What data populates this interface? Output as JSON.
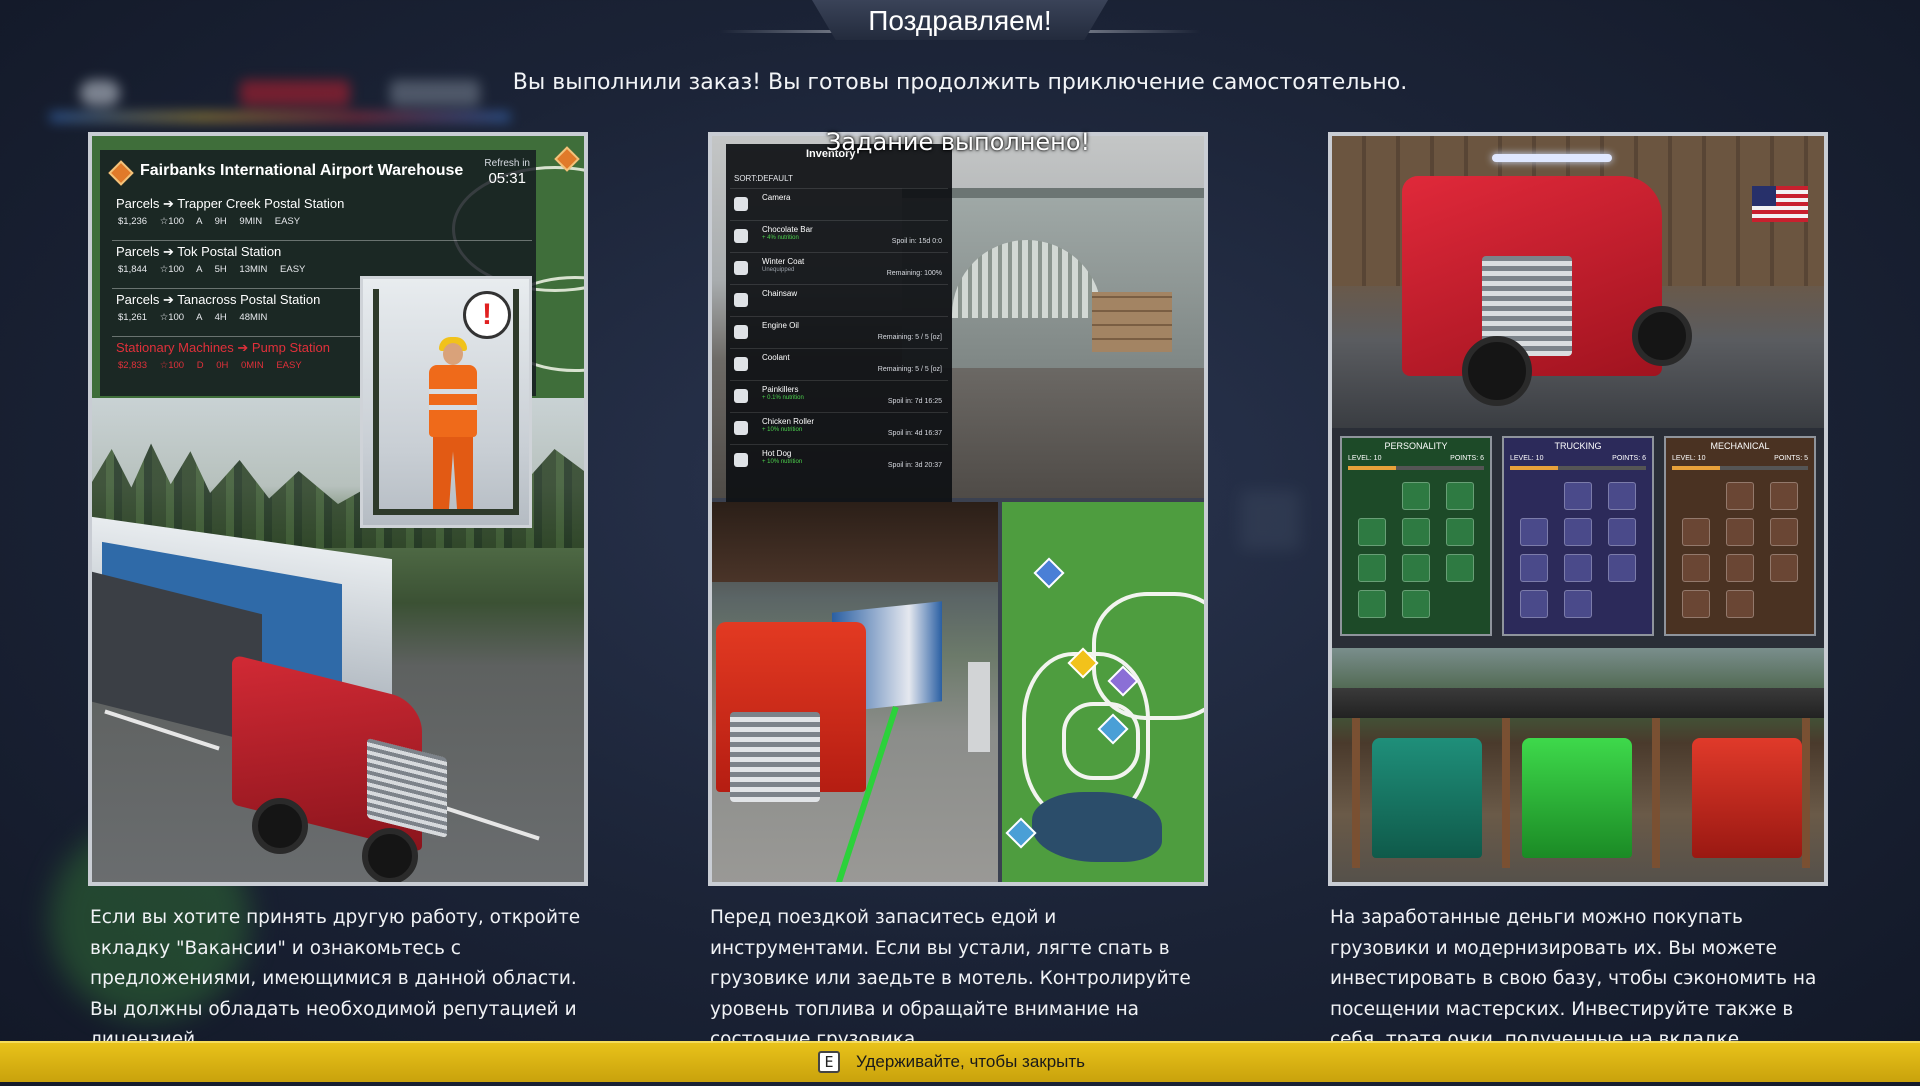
{
  "dialog": {
    "title": "Поздравляем!",
    "subtitle": "Вы выполнили заказ! Вы готовы продолжить приключение самостоятельно.",
    "close_key": "E",
    "close_hint": "Удерживайте, чтобы закрыть"
  },
  "panels": [
    {
      "description": "Если вы хотите принять другую работу, откройте вкладку \"Вакансии\" и ознакомьтесь с предложениями, имеющимися в данной области. Вы должны обладать необходимой репутацией и лицензией.",
      "job_board": {
        "title": "Fairbanks International Airport Warehouse",
        "refresh_label": "Refresh in",
        "refresh_time": "05:31",
        "jobs": [
          {
            "route": "Parcels ➔ Trapper Creek Postal Station",
            "stats": "$1,236 ☆100 A 9H 9MIN EASY",
            "locked": false
          },
          {
            "route": "Parcels ➔ Tok Postal Station",
            "stats": "$1,844 ☆100 A 5H 13MIN EASY",
            "locked": false
          },
          {
            "route": "Parcels ➔ Tanacross Postal Station",
            "stats": "$1,261 ☆100 A 4H 48MIN",
            "locked": false
          },
          {
            "route": "Stationary Machines ➔ Pump Station",
            "stats": "$2,833 ☆100 D 0H 0MIN EASY",
            "locked": true
          }
        ]
      }
    },
    {
      "description": "Перед поездкой запаситесь едой и инструментами. Если вы устали, лягте спать в грузовике или заедьте в мотель. Контролируйте уровень топлива и обращайте внимание на состояние грузовика.",
      "overlay_text": "Задание выполнено!",
      "inventory": {
        "title": "Inventory",
        "sort": "SORT:DEFAULT",
        "items": [
          {
            "name": "Camera",
            "sub": "",
            "info": ""
          },
          {
            "name": "Chocolate Bar",
            "sub": "+ 4% nutrition",
            "info": "Spoil in: 15d 0:0"
          },
          {
            "name": "Winter Coat",
            "sub": "Unequipped",
            "info": "Remaining: 100%"
          },
          {
            "name": "Chainsaw",
            "sub": "",
            "info": ""
          },
          {
            "name": "Engine Oil",
            "sub": "",
            "info": "Remaining: 5 / 5 [oz]"
          },
          {
            "name": "Coolant",
            "sub": "",
            "info": "Remaining: 5 / 5 [oz]"
          },
          {
            "name": "Painkillers",
            "sub": "+ 0.1% nutrition",
            "info": "Spoil in: 7d 16:25"
          },
          {
            "name": "Chicken Roller",
            "sub": "+ 10% nutrition",
            "info": "Spoil in: 4d 16:37"
          },
          {
            "name": "Hot Dog",
            "sub": "+ 10% nutrition",
            "info": "Spoil in: 3d 20:37"
          }
        ]
      }
    },
    {
      "description": " На заработанные деньги можно покупать грузовики и модернизировать их. Вы можете инвестировать в свою базу, чтобы сэкономить на посещении мастерских. Инвестируйте также в себя, тратя очки, полученные на вкладке \"Водитель\".",
      "skill_trees": [
        {
          "title": "PERSONALITY",
          "level": "LEVEL: 10",
          "points": "POINTS: 6",
          "progress": 0.35
        },
        {
          "title": "TRUCKING",
          "level": "LEVEL: 10",
          "points": "POINTS: 6",
          "progress": 0.35
        },
        {
          "title": "MECHANICAL",
          "level": "LEVEL: 10",
          "points": "POINTS: 5",
          "progress": 0.35
        }
      ]
    }
  ],
  "colors": {
    "accent_bar": "#e0bb18",
    "locked_job": "#e0303a",
    "nutrition_green": "#4cd14c"
  }
}
